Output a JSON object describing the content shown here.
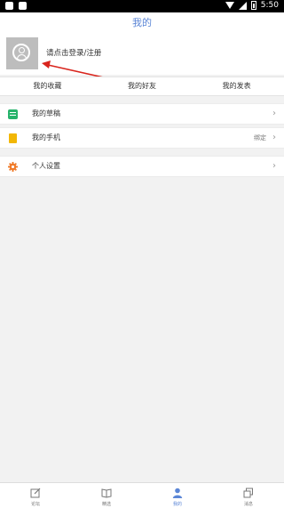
{
  "status_bar": {
    "time": "5:50"
  },
  "header": {
    "title": "我的"
  },
  "profile": {
    "login_text": "请点击登录/注册"
  },
  "tabs": [
    {
      "label": "我的收藏"
    },
    {
      "label": "我的好友"
    },
    {
      "label": "我的发表"
    }
  ],
  "menu": [
    {
      "label": "我的草稿",
      "extra": "",
      "icon": "draft-icon"
    },
    {
      "label": "我的手机",
      "extra": "绑定",
      "icon": "phone-icon"
    },
    {
      "label": "个人设置",
      "extra": "",
      "icon": "gear-icon"
    }
  ],
  "bottom_nav": [
    {
      "label": "论坛",
      "icon": "edit-icon"
    },
    {
      "label": "精选",
      "icon": "book-icon"
    },
    {
      "label": "我的",
      "icon": "user-icon",
      "active": true
    },
    {
      "label": "消息",
      "icon": "copy-icon"
    }
  ],
  "colors": {
    "accent": "#5b86d6",
    "green": "#27b36b",
    "yellow": "#f2b705",
    "orange": "#f07b2a",
    "arrow": "#d9251d"
  }
}
